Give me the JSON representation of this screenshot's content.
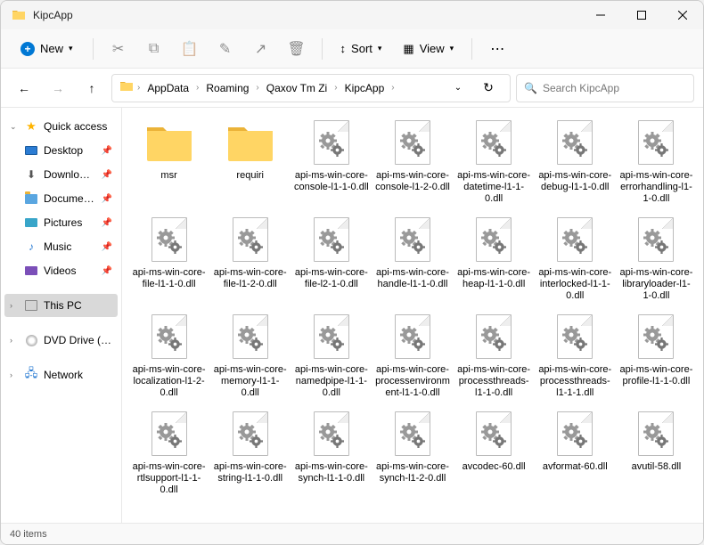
{
  "window": {
    "title": "KipcApp"
  },
  "toolbar": {
    "new_label": "New",
    "sort_label": "Sort",
    "view_label": "View"
  },
  "breadcrumb": {
    "items": [
      "AppData",
      "Roaming",
      "Qaxov Tm Zi",
      "KipcApp"
    ]
  },
  "search": {
    "placeholder": "Search KipcApp"
  },
  "sidebar": {
    "quick_access": "Quick access",
    "items": [
      {
        "label": "Desktop",
        "icon": "desktop",
        "pinned": true
      },
      {
        "label": "Downloads",
        "icon": "downloads",
        "pinned": true
      },
      {
        "label": "Documents",
        "icon": "documents",
        "pinned": true
      },
      {
        "label": "Pictures",
        "icon": "pictures",
        "pinned": true
      },
      {
        "label": "Music",
        "icon": "music",
        "pinned": true
      },
      {
        "label": "Videos",
        "icon": "videos",
        "pinned": true
      }
    ],
    "this_pc": "This PC",
    "dvd": "DVD Drive (D:) CCCC",
    "network": "Network"
  },
  "files": [
    {
      "name": "msr",
      "type": "folder"
    },
    {
      "name": "requiri",
      "type": "folder"
    },
    {
      "name": "api-ms-win-core-console-l1-1-0.dll",
      "type": "dll"
    },
    {
      "name": "api-ms-win-core-console-l1-2-0.dll",
      "type": "dll"
    },
    {
      "name": "api-ms-win-core-datetime-l1-1-0.dll",
      "type": "dll"
    },
    {
      "name": "api-ms-win-core-debug-l1-1-0.dll",
      "type": "dll"
    },
    {
      "name": "api-ms-win-core-errorhandling-l1-1-0.dll",
      "type": "dll"
    },
    {
      "name": "api-ms-win-core-file-l1-1-0.dll",
      "type": "dll"
    },
    {
      "name": "api-ms-win-core-file-l1-2-0.dll",
      "type": "dll"
    },
    {
      "name": "api-ms-win-core-file-l2-1-0.dll",
      "type": "dll"
    },
    {
      "name": "api-ms-win-core-handle-l1-1-0.dll",
      "type": "dll"
    },
    {
      "name": "api-ms-win-core-heap-l1-1-0.dll",
      "type": "dll"
    },
    {
      "name": "api-ms-win-core-interlocked-l1-1-0.dll",
      "type": "dll"
    },
    {
      "name": "api-ms-win-core-libraryloader-l1-1-0.dll",
      "type": "dll"
    },
    {
      "name": "api-ms-win-core-localization-l1-2-0.dll",
      "type": "dll"
    },
    {
      "name": "api-ms-win-core-memory-l1-1-0.dll",
      "type": "dll"
    },
    {
      "name": "api-ms-win-core-namedpipe-l1-1-0.dll",
      "type": "dll"
    },
    {
      "name": "api-ms-win-core-processenvironment-l1-1-0.dll",
      "type": "dll"
    },
    {
      "name": "api-ms-win-core-processthreads-l1-1-0.dll",
      "type": "dll"
    },
    {
      "name": "api-ms-win-core-processthreads-l1-1-1.dll",
      "type": "dll"
    },
    {
      "name": "api-ms-win-core-profile-l1-1-0.dll",
      "type": "dll"
    },
    {
      "name": "api-ms-win-core-rtlsupport-l1-1-0.dll",
      "type": "dll"
    },
    {
      "name": "api-ms-win-core-string-l1-1-0.dll",
      "type": "dll"
    },
    {
      "name": "api-ms-win-core-synch-l1-1-0.dll",
      "type": "dll"
    },
    {
      "name": "api-ms-win-core-synch-l1-2-0.dll",
      "type": "dll"
    },
    {
      "name": "avcodec-60.dll",
      "type": "dll"
    },
    {
      "name": "avformat-60.dll",
      "type": "dll"
    },
    {
      "name": "avutil-58.dll",
      "type": "dll"
    }
  ],
  "status": {
    "item_count": "40 items"
  }
}
